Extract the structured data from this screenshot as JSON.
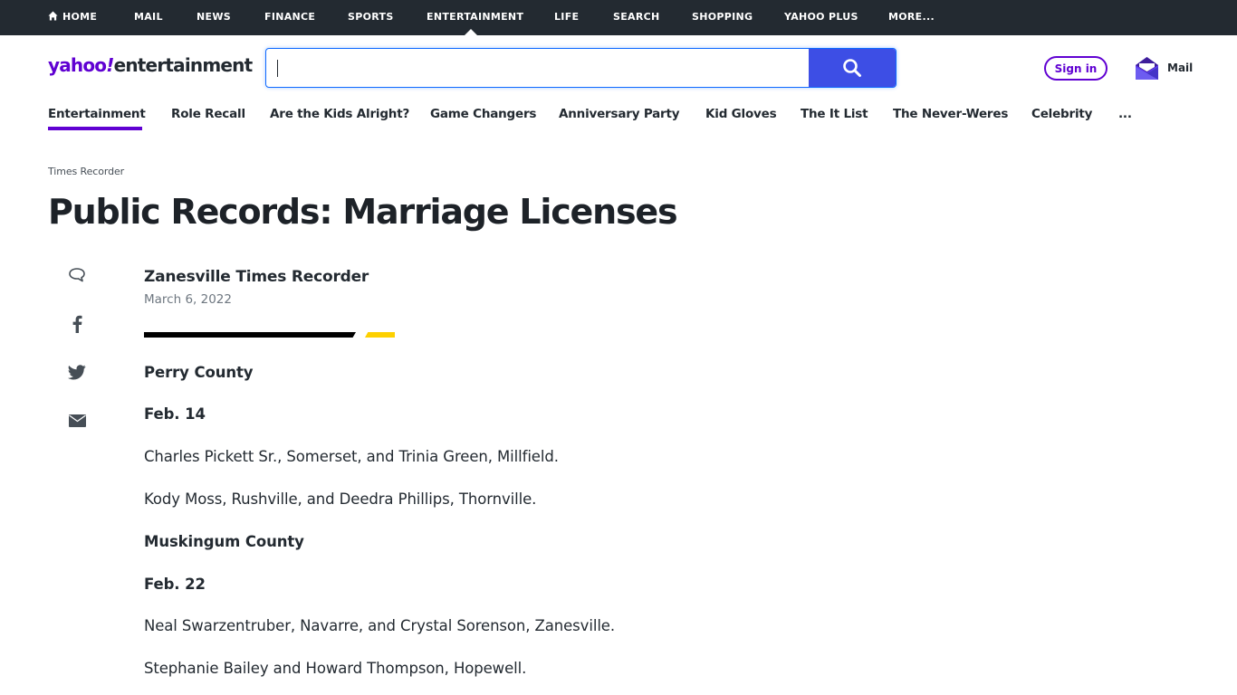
{
  "topnav": {
    "items": [
      "HOME",
      "MAIL",
      "NEWS",
      "FINANCE",
      "SPORTS",
      "ENTERTAINMENT",
      "LIFE",
      "SEARCH",
      "SHOPPING",
      "YAHOO PLUS",
      "MORE..."
    ],
    "active": "ENTERTAINMENT"
  },
  "header": {
    "logo": {
      "brand": "yahoo",
      "bang": "!",
      "section": "entertainment"
    },
    "search": {
      "value": "",
      "placeholder": ""
    },
    "signin_label": "Sign in",
    "mail_label": "Mail"
  },
  "subnav": {
    "items": [
      "Entertainment",
      "Role Recall",
      "Are the Kids Alright?",
      "Game Changers",
      "Anniversary Party",
      "Kid Gloves",
      "The It List",
      "The Never-Weres",
      "Celebrity",
      "..."
    ],
    "active": "Entertainment"
  },
  "article": {
    "provider": "Times Recorder",
    "title": "Public Records: Marriage Licenses",
    "author": "Zanesville Times Recorder",
    "date": "March 6, 2022",
    "share_icons": [
      "comment-icon",
      "facebook-icon",
      "twitter-icon",
      "email-icon"
    ],
    "paragraphs": [
      {
        "text": "Perry County",
        "bold": true
      },
      {
        "text": "Feb. 14",
        "bold": true
      },
      {
        "text": "Charles Pickett Sr., Somerset, and Trinia Green, Millfield.",
        "bold": false
      },
      {
        "text": "Kody Moss, Rushville, and Deedra Phillips, Thornville.",
        "bold": false
      },
      {
        "text": "Muskingum County",
        "bold": true
      },
      {
        "text": "Feb. 22",
        "bold": true
      },
      {
        "text": "Neal Swarzentruber, Navarre, and Crystal Sorenson, Zanesville.",
        "bold": false
      },
      {
        "text": "Stephanie Bailey and Howard Thompson, Hopewell.",
        "bold": false
      }
    ]
  },
  "colors": {
    "brand_purple": "#6001d2",
    "search_blue": "#3d4ee5",
    "topnav_bg": "#232a31",
    "accent_yellow": "#fdd000"
  }
}
